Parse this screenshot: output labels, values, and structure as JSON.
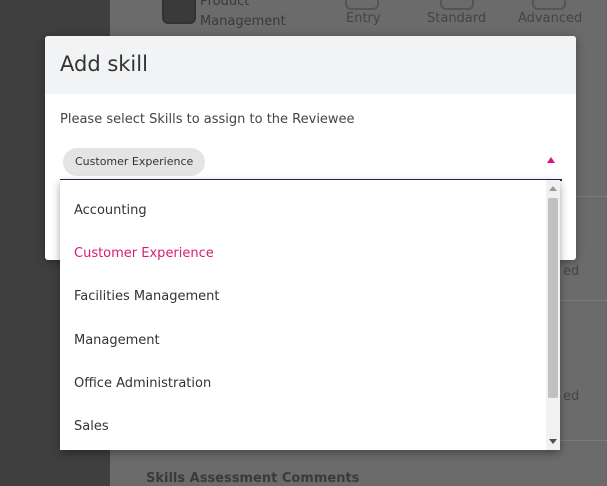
{
  "background": {
    "product_label_line1": "Product",
    "product_label_line2": "Management",
    "levels": [
      "Entry",
      "Standard",
      "Advanced"
    ],
    "comments_heading": "Skills Assessment Comments",
    "side_fragments": [
      "ed",
      "ed"
    ]
  },
  "modal": {
    "title": "Add skill",
    "description": "Please select Skills to assign to the Reviewee",
    "selected_chip": "Customer Experience"
  },
  "dropdown": {
    "options": [
      "Accounting",
      "Customer Experience",
      "Facilities Management",
      "Management",
      "Office Administration",
      "Sales"
    ],
    "selected": "Customer Experience"
  },
  "colors": {
    "accent": "#d81b78",
    "underline": "#1f2a44"
  }
}
